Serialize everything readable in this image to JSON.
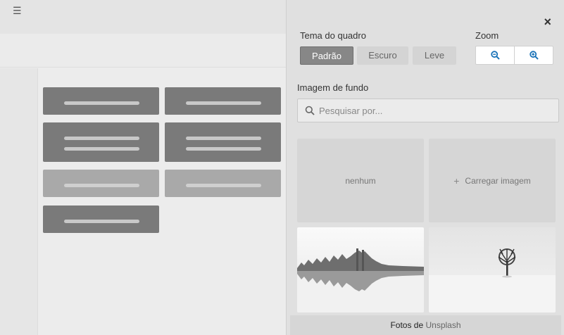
{
  "board": {
    "menu_icon": "hamburger-icon"
  },
  "panel": {
    "close_label": "×",
    "theme": {
      "label": "Tema do quadro",
      "options": [
        "Padrão",
        "Escuro",
        "Leve"
      ],
      "selected": "Padrão"
    },
    "zoom": {
      "label": "Zoom",
      "zoom_out_icon": "zoom-out-icon",
      "zoom_in_icon": "zoom-in-icon"
    },
    "background": {
      "label": "Imagem de fundo",
      "search_placeholder": "Pesquisar por...",
      "none_label": "nenhum",
      "upload_label": "Carregar imagem",
      "upload_icon": "plus-icon",
      "photos": [
        "lake-trees-photo",
        "lone-tree-photo"
      ]
    },
    "footer": {
      "prefix": "Fotos de",
      "link": "Unsplash"
    }
  },
  "colors": {
    "accent": "#1a73b8",
    "selected_segment": "#878787"
  }
}
